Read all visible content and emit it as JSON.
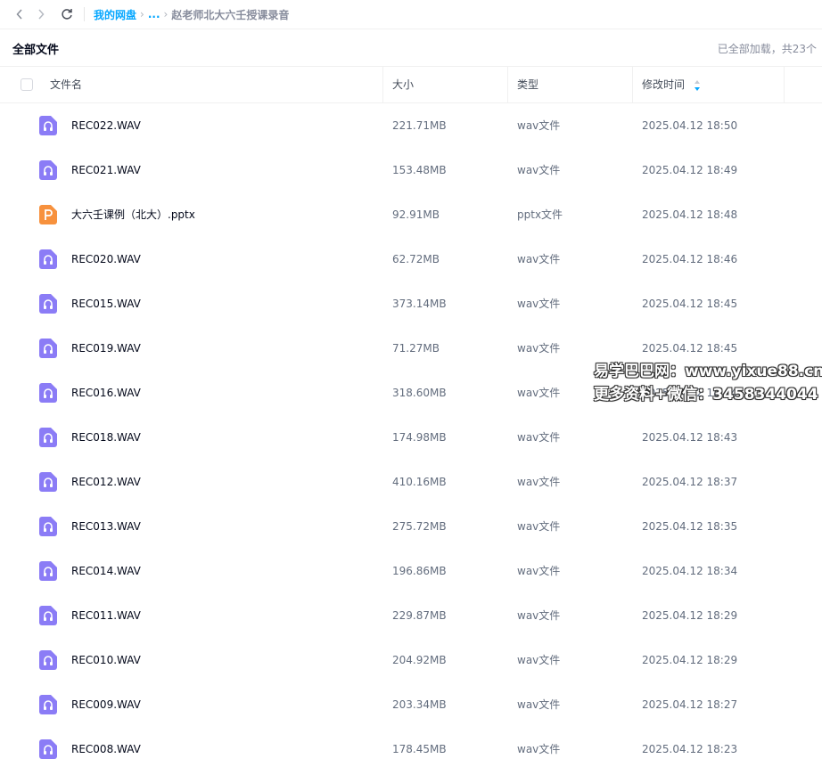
{
  "breadcrumb": {
    "root": "我的网盘",
    "ellipsis": "...",
    "chevron": "›",
    "current": "赵老师北大六壬授课录音"
  },
  "toolbar": {
    "title": "全部文件",
    "loaded_info": "已全部加载，共23个"
  },
  "table": {
    "columns": {
      "name": "文件名",
      "size": "大小",
      "type": "类型",
      "time": "修改时间"
    },
    "sorted_by": "time",
    "rows": [
      {
        "icon": "audio-file-icon",
        "name": "REC022.WAV",
        "size": "221.71MB",
        "type": "wav文件",
        "time": "2025.04.12 18:50"
      },
      {
        "icon": "audio-file-icon",
        "name": "REC021.WAV",
        "size": "153.48MB",
        "type": "wav文件",
        "time": "2025.04.12 18:49"
      },
      {
        "icon": "pptx-file-icon",
        "name": "大六壬课例（北大）.pptx",
        "size": "92.91MB",
        "type": "pptx文件",
        "time": "2025.04.12 18:48"
      },
      {
        "icon": "audio-file-icon",
        "name": "REC020.WAV",
        "size": "62.72MB",
        "type": "wav文件",
        "time": "2025.04.12 18:46"
      },
      {
        "icon": "audio-file-icon",
        "name": "REC015.WAV",
        "size": "373.14MB",
        "type": "wav文件",
        "time": "2025.04.12 18:45"
      },
      {
        "icon": "audio-file-icon",
        "name": "REC019.WAV",
        "size": "71.27MB",
        "type": "wav文件",
        "time": "2025.04.12 18:45"
      },
      {
        "icon": "audio-file-icon",
        "name": "REC016.WAV",
        "size": "318.60MB",
        "type": "wav文件",
        "time": "2025.04.12 18:44"
      },
      {
        "icon": "audio-file-icon",
        "name": "REC018.WAV",
        "size": "174.98MB",
        "type": "wav文件",
        "time": "2025.04.12 18:43"
      },
      {
        "icon": "audio-file-icon",
        "name": "REC012.WAV",
        "size": "410.16MB",
        "type": "wav文件",
        "time": "2025.04.12 18:37"
      },
      {
        "icon": "audio-file-icon",
        "name": "REC013.WAV",
        "size": "275.72MB",
        "type": "wav文件",
        "time": "2025.04.12 18:35"
      },
      {
        "icon": "audio-file-icon",
        "name": "REC014.WAV",
        "size": "196.86MB",
        "type": "wav文件",
        "time": "2025.04.12 18:34"
      },
      {
        "icon": "audio-file-icon",
        "name": "REC011.WAV",
        "size": "229.87MB",
        "type": "wav文件",
        "time": "2025.04.12 18:29"
      },
      {
        "icon": "audio-file-icon",
        "name": "REC010.WAV",
        "size": "204.92MB",
        "type": "wav文件",
        "time": "2025.04.12 18:29"
      },
      {
        "icon": "audio-file-icon",
        "name": "REC009.WAV",
        "size": "203.34MB",
        "type": "wav文件",
        "time": "2025.04.12 18:27"
      },
      {
        "icon": "audio-file-icon",
        "name": "REC008.WAV",
        "size": "178.45MB",
        "type": "wav文件",
        "time": "2025.04.12 18:23"
      }
    ]
  },
  "watermark": {
    "line1": "易学巴巴网：www.yixue88.cn",
    "line2": "更多资料+微信：3458344044"
  },
  "colors": {
    "accent": "#06a7ff",
    "audio_icon": "#8b7cf6",
    "pptx_icon": "#f7913d"
  }
}
